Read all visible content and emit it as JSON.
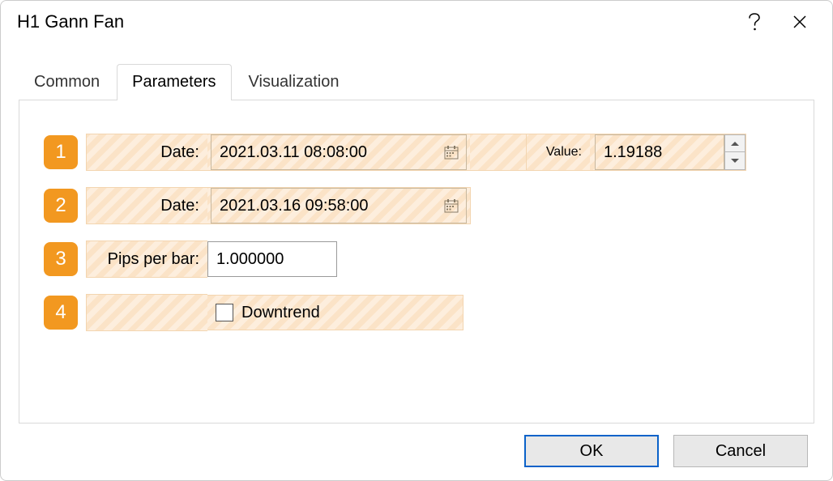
{
  "window": {
    "title": "H1 Gann Fan"
  },
  "tabs": {
    "common": "Common",
    "parameters": "Parameters",
    "visualization": "Visualization"
  },
  "rows": {
    "r1": {
      "badge": "1",
      "label": "Date:",
      "date": "2021.03.11 08:08:00",
      "value_label": "Value:",
      "value": "1.19188"
    },
    "r2": {
      "badge": "2",
      "label": "Date:",
      "date": "2021.03.16 09:58:00"
    },
    "r3": {
      "badge": "3",
      "label": "Pips per bar:",
      "value": "1.000000"
    },
    "r4": {
      "badge": "4",
      "checkbox_label": "Downtrend",
      "checked": false
    }
  },
  "buttons": {
    "ok": "OK",
    "cancel": "Cancel"
  }
}
